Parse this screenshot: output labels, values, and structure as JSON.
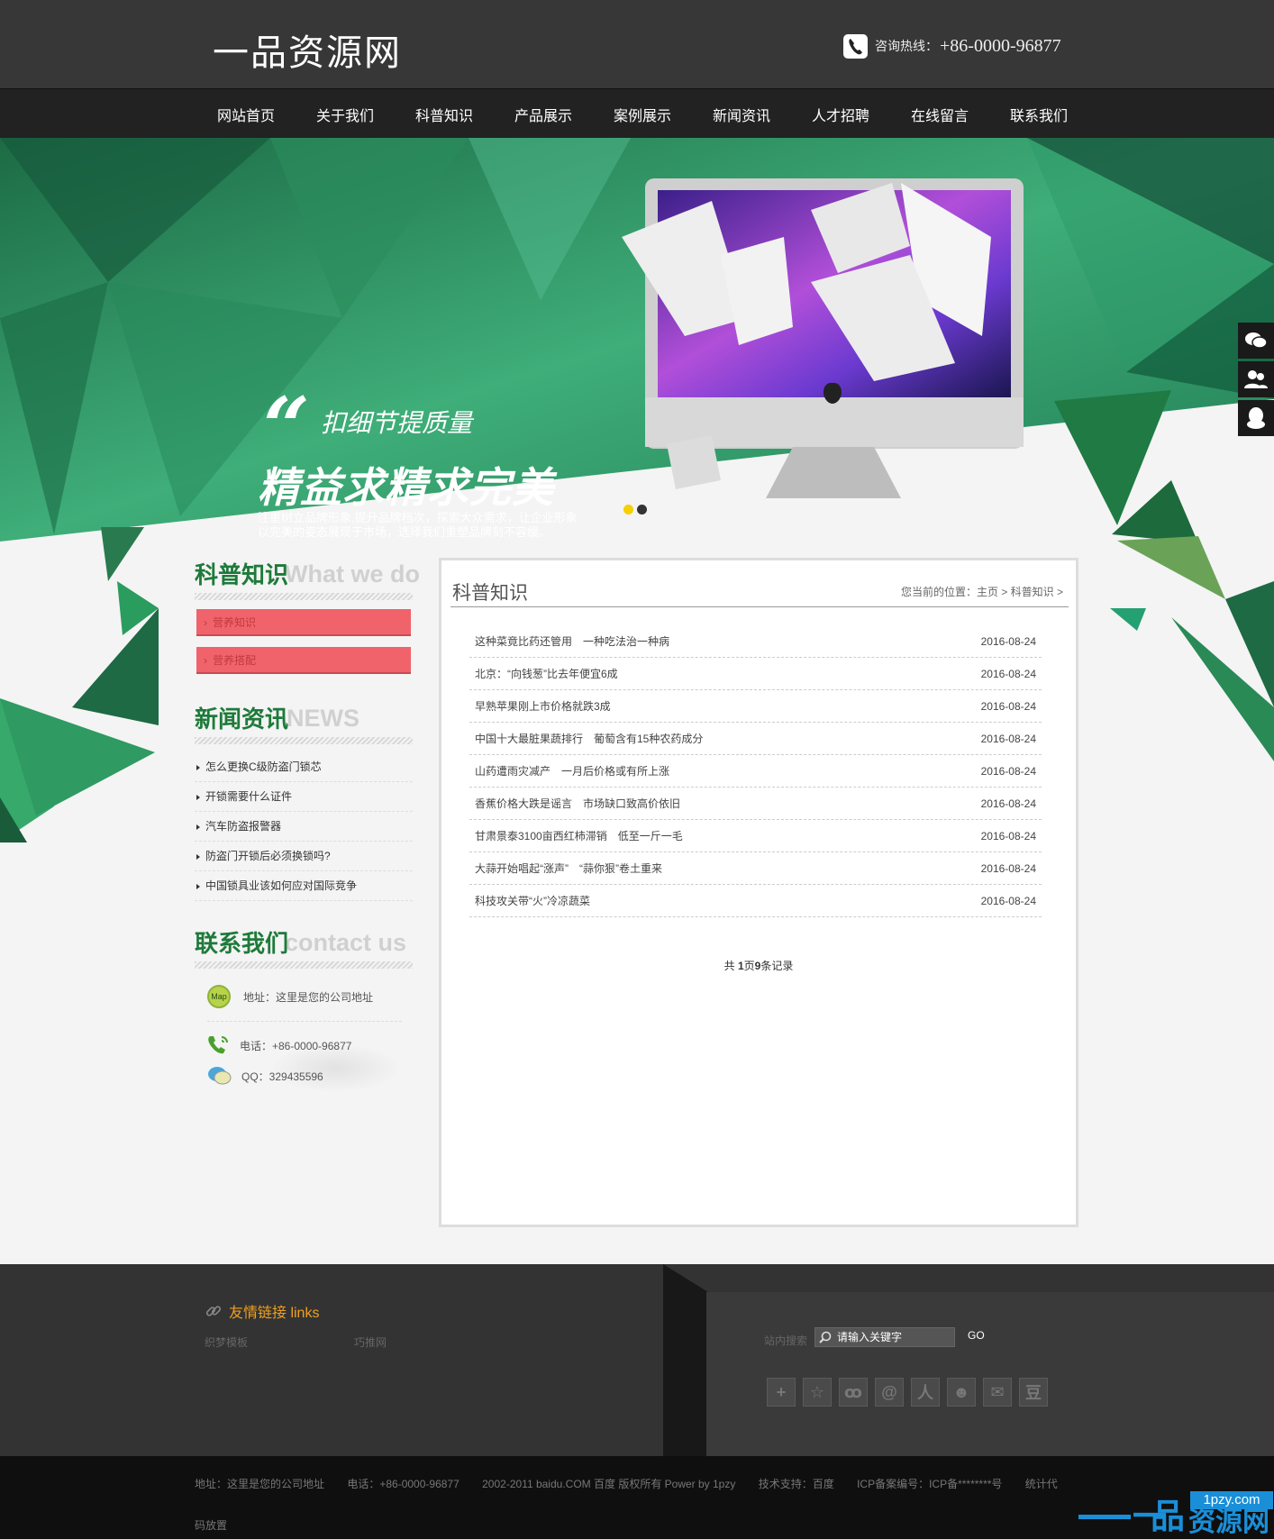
{
  "header": {
    "logo": "一品资源网",
    "hotline_label": "咨询热线：",
    "hotline_number": "+86-0000-96877"
  },
  "nav": [
    "网站首页",
    "关于我们",
    "科普知识",
    "产品展示",
    "案例展示",
    "新闻资讯",
    "人才招聘",
    "在线留言",
    "联系我们"
  ],
  "banner": {
    "slogan1": "扣细节提质量",
    "slogan2": "精益求精求完美",
    "slogan3": "注重树立品牌形象,提升品牌档次，探索大众需求，让企业形象以完美的姿态展现于市场，选择我们重塑品牌刻不容缓。",
    "quote": "“",
    "active_dot_color": "#f6d000",
    "inactive_dot_color": "#333333"
  },
  "sidebar": {
    "category": {
      "title_cn": "科普知识",
      "title_en": "What we do",
      "items": [
        "营养知识",
        "营养搭配"
      ]
    },
    "news": {
      "title_cn": "新闻资讯",
      "title_en": "NEWS",
      "items": [
        "怎么更换C级防盗门锁芯",
        "开锁需要什么证件",
        "汽车防盗报警器",
        "防盗门开锁后必须换锁吗?",
        "中国锁具业该如何应对国际竞争"
      ]
    },
    "contact": {
      "title_cn": "联系我们",
      "title_en": "contact us",
      "map_badge": "Map",
      "address": "地址：这里是您的公司地址",
      "phone": "电话：+86-0000-96877",
      "qq": "QQ：329435596"
    }
  },
  "main": {
    "title": "科普知识",
    "breadcrumb": "您当前的位置：主页 > 科普知识 >",
    "articles": [
      {
        "title": "这种菜竟比药还管用　一种吃法治一种病",
        "date": "2016-08-24"
      },
      {
        "title": "北京：“向钱葱”比去年便宜6成",
        "date": "2016-08-24"
      },
      {
        "title": "早熟苹果刚上市价格就跌3成",
        "date": "2016-08-24"
      },
      {
        "title": "中国十大最脏果蔬排行　葡萄含有15种农药成分",
        "date": "2016-08-24"
      },
      {
        "title": "山药遭雨灾减产　一月后价格或有所上涨",
        "date": "2016-08-24"
      },
      {
        "title": "香蕉价格大跌是谣言　市场缺口致高价依旧",
        "date": "2016-08-24"
      },
      {
        "title": "甘肃景泰3100亩西红柿滞销　低至一斤一毛",
        "date": "2016-08-24"
      },
      {
        "title": "大蒜开始唱起“涨声”　“蒜你狠”卷土重来",
        "date": "2016-08-24"
      },
      {
        "title": "科技攻关带“火”冷凉蔬菜",
        "date": "2016-08-24"
      }
    ],
    "pager": {
      "prefix": "共",
      "pages": "1",
      "mid": "页",
      "records": "9",
      "suffix": "条记录"
    }
  },
  "footer": {
    "links_title": "友情链接 links",
    "links": [
      "织梦模板",
      "巧推网"
    ],
    "search_label": "站内搜索",
    "search_placeholder": "请输入关键字",
    "go": "GO",
    "share_icons": [
      "plus-icon",
      "star-icon",
      "weibo-icon",
      "tencent-weibo-icon",
      "renren-icon",
      "kaixin-icon",
      "netease-icon",
      "douban-icon"
    ],
    "share_glyphs": [
      "+",
      "☆",
      "ꝏ",
      "@",
      "人",
      "☻",
      "✉",
      "豆"
    ],
    "copyright": [
      "地址：这里是您的公司地址",
      "电话：+86-0000-96877",
      "2002-2011 baidu.COM 百度 版权所有 Power by 1pzy",
      "技术支持：百度",
      "ICP备案编号：ICP备********号",
      "统计代"
    ],
    "copyright_line2": "码放置",
    "watermark_domain": "1pzy.com",
    "watermark_text": "资源网",
    "watermark_logo": "一品"
  }
}
